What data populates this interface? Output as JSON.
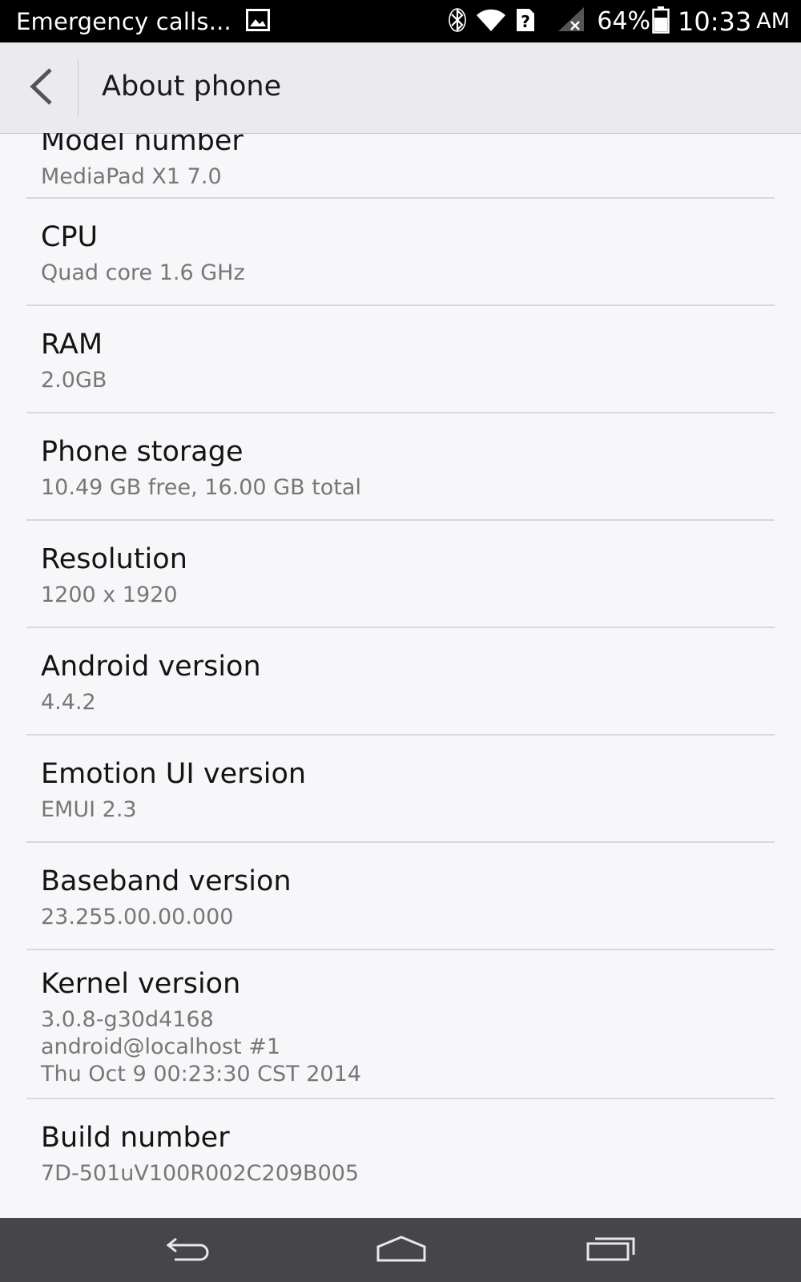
{
  "status_bar": {
    "notification_text": "Emergency calls...",
    "battery_percent": "64%",
    "time": "10:33",
    "ampm": "AM"
  },
  "action_bar": {
    "title": "About phone"
  },
  "items": [
    {
      "title": "Model number",
      "value": "MediaPad X1 7.0"
    },
    {
      "title": "CPU",
      "value": "Quad core 1.6 GHz"
    },
    {
      "title": "RAM",
      "value": "2.0GB"
    },
    {
      "title": "Phone storage",
      "value": "10.49 GB free, 16.00 GB total"
    },
    {
      "title": "Resolution",
      "value": "1200 x 1920"
    },
    {
      "title": "Android version",
      "value": "4.4.2"
    },
    {
      "title": "Emotion UI version",
      "value": "EMUI 2.3"
    },
    {
      "title": "Baseband version",
      "value": "23.255.00.00.000"
    },
    {
      "title": "Kernel version",
      "value_lines": [
        "3.0.8-g30d4168",
        "android@localhost #1",
        "Thu Oct 9 00:23:30 CST 2014"
      ]
    },
    {
      "title": "Build number",
      "value": "7D-501uV100R002C209B005"
    }
  ],
  "icons": {
    "status_left": [
      "image-icon"
    ],
    "status_right": [
      "bluetooth-icon",
      "wifi-icon",
      "sim-unknown-icon",
      "signal-off-icon",
      "battery-icon"
    ],
    "nav": [
      "back-nav-icon",
      "home-nav-icon",
      "recents-nav-icon"
    ]
  }
}
